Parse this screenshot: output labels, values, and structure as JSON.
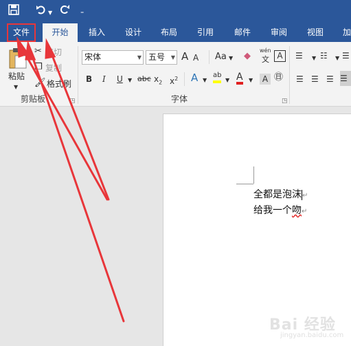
{
  "quick_access": {
    "save_icon": "save-icon",
    "undo_icon": "undo-icon",
    "undo_dropdown_icon": "chevron-down-icon",
    "redo_icon": "redo-icon",
    "customize_icon": "customize-qat-icon"
  },
  "tabs": [
    {
      "label": "文件"
    },
    {
      "label": "开始"
    },
    {
      "label": "插入"
    },
    {
      "label": "设计"
    },
    {
      "label": "布局"
    },
    {
      "label": "引用"
    },
    {
      "label": "邮件"
    },
    {
      "label": "审阅"
    },
    {
      "label": "视图"
    },
    {
      "label": "加"
    }
  ],
  "clipboard": {
    "paste_label": "粘贴",
    "cut_label": "剪切",
    "copy_label": "复制",
    "format_painter_label": "格式刷",
    "group_label": "剪贴板"
  },
  "font": {
    "font_name": "宋体",
    "font_size": "五号",
    "grow_label": "A",
    "shrink_label": "A",
    "case_label": "Aa",
    "phonetic_top": "wén",
    "phonetic_bottom": "文",
    "charborder_label": "A",
    "bold_label": "B",
    "italic_label": "I",
    "underline_label": "U",
    "strike_label": "abc",
    "subscript_label": "x",
    "subscript_sub": "2",
    "superscript_label": "x",
    "superscript_sup": "2",
    "effects_label": "A",
    "highlight_label": "ab",
    "fontcolor_label": "A",
    "group_label": "字体"
  },
  "colors": {
    "ribbon_blue": "#2b579a",
    "annotation_red": "#e8363a",
    "highlight_yellow": "#ffff00",
    "font_color_red": "#e02020"
  },
  "document": {
    "lines": [
      {
        "text": "全都是泡沫"
      },
      {
        "text": "给我一个",
        "tail_squiggle": "吻"
      }
    ],
    "paragraph_mark": "↵"
  },
  "watermark": {
    "text": "Bai 经验",
    "sub": "jingyan.baidu.com"
  }
}
